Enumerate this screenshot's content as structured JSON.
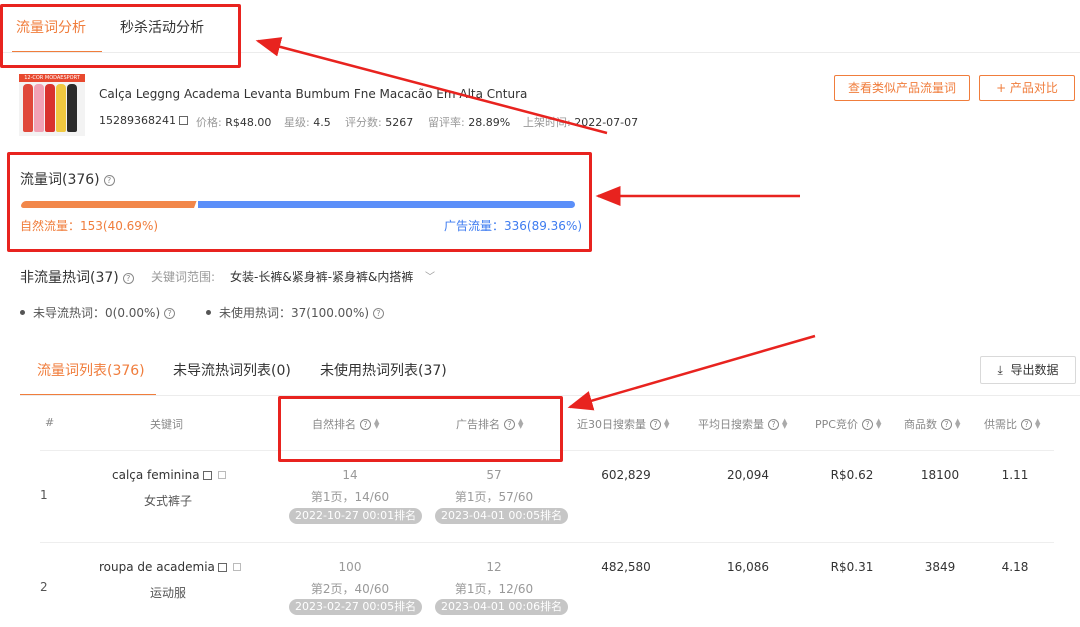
{
  "top_tabs": [
    {
      "label": "流量词分析",
      "active": true
    },
    {
      "label": "秒杀活动分析",
      "active": false
    }
  ],
  "product": {
    "thumb_banner": "12-COR MODAESPORT",
    "title": "Calça Leggng Academa Levanta Bumbum Fne Macacão Em Alta Cntura",
    "id": "15289368241",
    "price_label": "价格:",
    "price": "R$48.00",
    "level_label": "星级:",
    "level": "4.5",
    "reviews_label": "评分数:",
    "reviews": "5267",
    "retention_label": "留评率:",
    "retention": "28.89%",
    "listed_label": "上架时间:",
    "listed": "2022-07-07"
  },
  "buttons": {
    "similar": "查看类似产品流量词",
    "compare": "+  产品对比",
    "export": "导出数据"
  },
  "traffic": {
    "title": "流量词(376)",
    "natural": "自然流量：153(40.69%)",
    "ad": "广告流量：336(89.36%)",
    "natural_fraction": 0.3127,
    "colors": {
      "natural": "#f2874a",
      "ad": "#5b8ff9"
    }
  },
  "non_traffic": {
    "title": "非流量热词(37)",
    "range_label": "关键词范围:",
    "range_value": "女装-长裤&紧身裤-紧身裤&内搭裤",
    "stat1": "未导流热词：0(0.00%)",
    "stat2": "未使用热词：37(100.00%)"
  },
  "list_tabs": [
    {
      "label": "流量词列表(376)",
      "active": true
    },
    {
      "label": "未导流热词列表(0)",
      "active": false
    },
    {
      "label": "未使用热词列表(37)",
      "active": false
    }
  ],
  "table": {
    "headers": {
      "index": "#",
      "keyword": "关键词",
      "natural_rank": "自然排名",
      "ad_rank": "广告排名",
      "search30": "近30日搜索量",
      "avg_daily": "平均日搜索量",
      "ppc": "PPC竞价",
      "products": "商品数",
      "supply": "供需比"
    },
    "rows": [
      {
        "index": "1",
        "keyword": "calça feminina",
        "translation": "女式裤子",
        "natural_rank": "14",
        "natural_page": "第1页，14/60",
        "natural_time": "2022-10-27 00:01排名",
        "ad_rank": "57",
        "ad_page": "第1页，57/60",
        "ad_time": "2023-04-01 00:05排名",
        "search30": "602,829",
        "avg_daily": "20,094",
        "ppc": "R$0.62",
        "products": "18100",
        "supply": "1.11"
      },
      {
        "index": "2",
        "keyword": "roupa de academia",
        "translation": "运动服",
        "natural_rank": "100",
        "natural_page": "第2页，40/60",
        "natural_time": "2023-02-27 00:05排名",
        "ad_rank": "12",
        "ad_page": "第1页，12/60",
        "ad_time": "2023-04-01 00:06排名",
        "search30": "482,580",
        "avg_daily": "16,086",
        "ppc": "R$0.31",
        "products": "3849",
        "supply": "4.18"
      }
    ]
  },
  "annotation_color": "#e8231f"
}
